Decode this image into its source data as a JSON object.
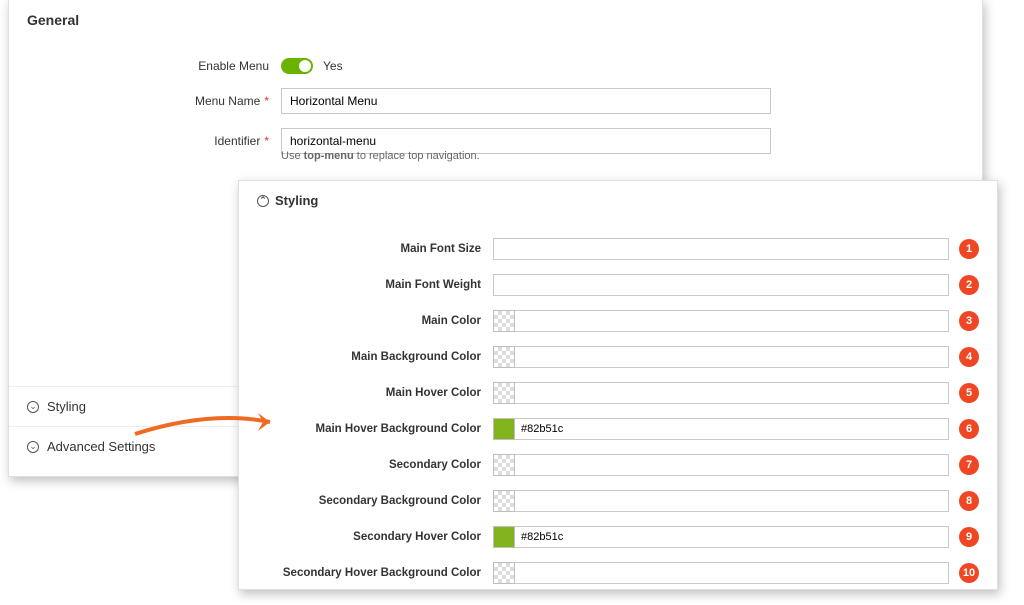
{
  "general": {
    "title": "General",
    "enable_label": "Enable Menu",
    "enable_value_text": "Yes",
    "menu_name_label": "Menu Name",
    "menu_name_value": "Horizontal Menu",
    "identifier_label": "Identifier",
    "identifier_value": "horizontal-menu",
    "identifier_hint_pre": "Use ",
    "identifier_hint_bold": "top-menu",
    "identifier_hint_post": " to replace top navigation."
  },
  "collapsers": {
    "styling": "Styling",
    "advanced": "Advanced Settings"
  },
  "styling_panel": {
    "title": "Styling",
    "rows": [
      {
        "label": "Main Font Size",
        "swatch": null,
        "value": "",
        "marker": "1"
      },
      {
        "label": "Main Font Weight",
        "swatch": null,
        "value": "",
        "marker": "2"
      },
      {
        "label": "Main Color",
        "swatch": "checker",
        "value": "",
        "marker": "3"
      },
      {
        "label": "Main Background Color",
        "swatch": "checker",
        "value": "",
        "marker": "4"
      },
      {
        "label": "Main Hover Color",
        "swatch": "checker",
        "value": "",
        "marker": "5"
      },
      {
        "label": "Main Hover Background Color",
        "swatch": "#82b51c",
        "value": "#82b51c",
        "marker": "6"
      },
      {
        "label": "Secondary Color",
        "swatch": "checker",
        "value": "",
        "marker": "7"
      },
      {
        "label": "Secondary Background Color",
        "swatch": "checker",
        "value": "",
        "marker": "8"
      },
      {
        "label": "Secondary Hover Color",
        "swatch": "#82b51c",
        "value": "#82b51c",
        "marker": "9"
      },
      {
        "label": "Secondary Hover Background Color",
        "swatch": "checker",
        "value": "",
        "marker": "10"
      }
    ]
  },
  "colors": {
    "accent_green": "#6bb301",
    "marker_red": "#ef4723",
    "required_red": "#e02b27"
  }
}
